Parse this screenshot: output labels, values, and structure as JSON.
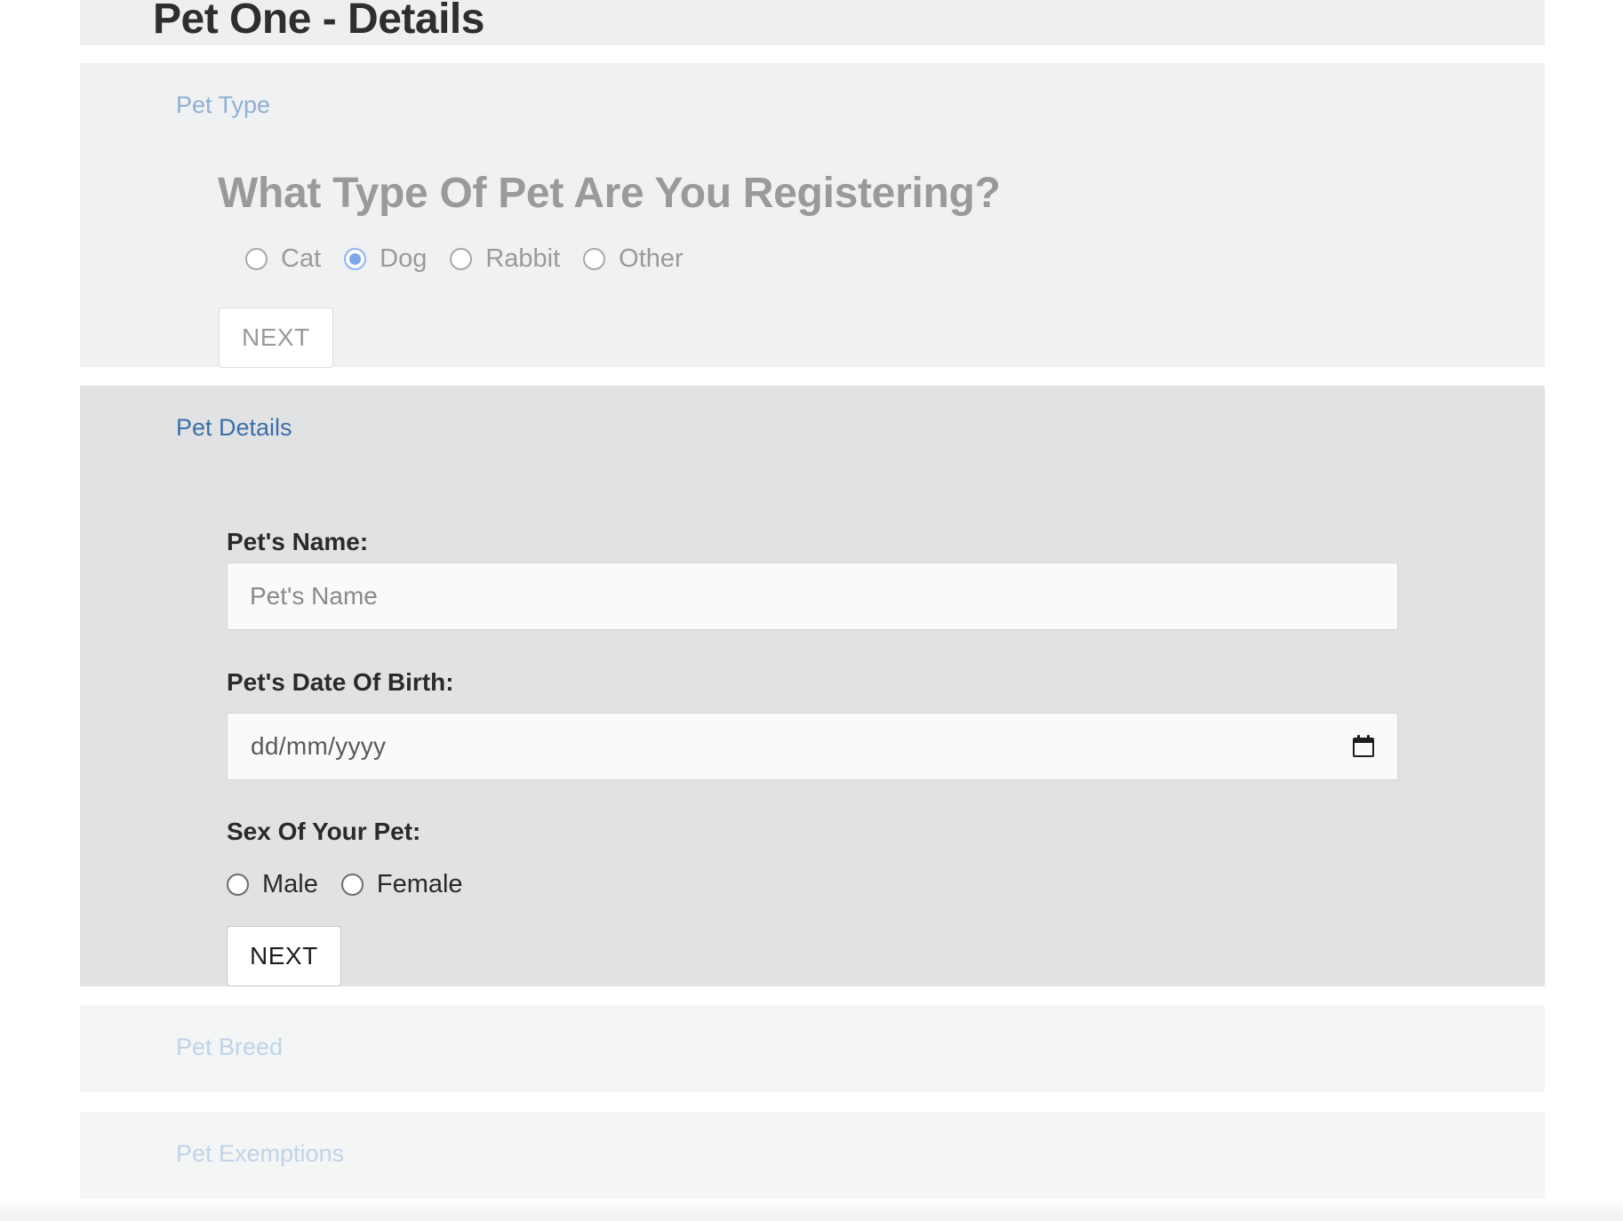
{
  "page": {
    "title": "Pet One - Details"
  },
  "steps": {
    "pet_type": {
      "label": "Pet Type",
      "question": "What Type Of Pet Are You Registering?",
      "options": [
        "Cat",
        "Dog",
        "Rabbit",
        "Other"
      ],
      "selected": "Dog",
      "next_label": "NEXT"
    },
    "pet_details": {
      "label": "Pet Details",
      "name_label": "Pet's Name:",
      "name_placeholder": "Pet's Name",
      "name_value": "",
      "dob_label": "Pet's Date Of Birth:",
      "dob_placeholder": "dd/mm/yyyy",
      "sex_label": "Sex Of Your Pet:",
      "sex_options": [
        "Male",
        "Female"
      ],
      "sex_selected": "",
      "next_label": "NEXT"
    },
    "pet_breed": {
      "label": "Pet Breed"
    },
    "pet_exemptions": {
      "label": "Pet Exemptions"
    }
  },
  "colors": {
    "active_step_label": "#3d6fa9",
    "completed_step_label": "#8fb0d4",
    "pending_step_label": "#c0d3e8",
    "radio_checked": "#7ba7e8"
  },
  "icons": {
    "date_picker": "calendar-icon"
  }
}
